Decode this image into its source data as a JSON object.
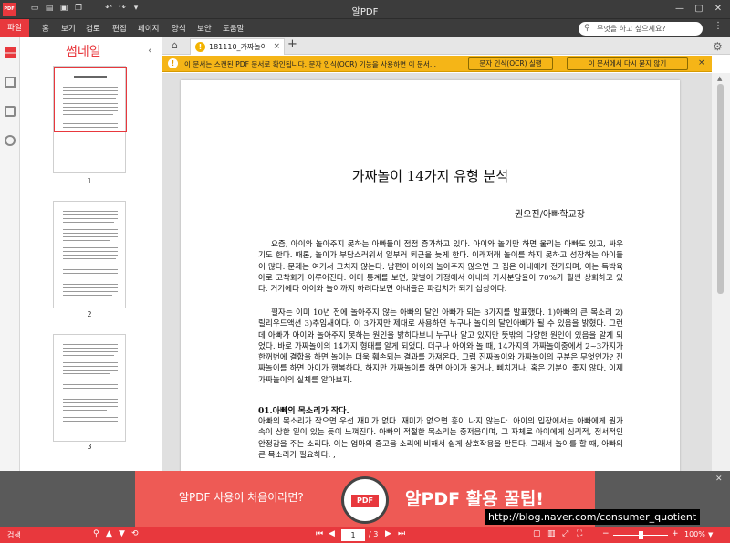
{
  "app": {
    "title": "알PDF",
    "logo_text": "PDF"
  },
  "quick_access": [
    "open-icon",
    "save-icon",
    "print-icon",
    "copy-icon",
    "undo-icon",
    "redo-icon",
    "customize-icon"
  ],
  "menu": {
    "file": "파일",
    "items": [
      "홈",
      "보기",
      "검토",
      "편집",
      "페이지",
      "양식",
      "보안",
      "도움말"
    ]
  },
  "search": {
    "placeholder": "무엇을 하고 싶으세요?"
  },
  "sidebar": {
    "title": "썸네일",
    "pages": [
      "1",
      "2",
      "3"
    ]
  },
  "tab": {
    "label": "181110_가짜놀이",
    "close": "×"
  },
  "ocr_bar": {
    "message": "이 문서는 스캔된 PDF 문서로 확인됩니다. 문자 인식(OCR) 기능을 사용하면 이 문서...",
    "run_button": "문자 인식(OCR) 실행",
    "dismiss_button": "이 문서에서 다시 묻지 않기",
    "close": "×"
  },
  "document": {
    "title": "가짜놀이 14가지 유형 분석",
    "author": "권오진/아빠학교장",
    "para1": "요즘, 아이와 놀아주지 못하는 아빠들이 점점 증가하고 있다. 아이와 놀기만 하면 울리는 아빠도 있고, 싸우기도 한다. 때론, 놀이가 부담스러워서 일부러 퇴근을 늦게 한다. 이래저래 놀이를 하지 못하고 성장하는 아이들이 많다. 문제는 여기서 그치지 않는다. 남편이 아이와 놀아주지 않으면 그 짐은 아내에게 전가되며, 이는 독박육아로 고착화가 이루어진다. 이미 통계를 보면, 맞벌이 가정에서 아내의 가사분담율이 70%가 훨씬 상회하고 있다. 거기에다 아이와 놀이까지 하려다보면 아내들은 파김치가 되기 십상이다.",
    "para2": "필자는 이미 10년 전에 놀아주지 않는 아빠의 달인 아빠가 되는 3가지를 발표했다. 1)아빠의 큰 목소리 2)릴리우드액션 3)추임새이다. 이 3가지만 제대로 사용하면 누구나 놀이의 달인아빠가 될 수 있음을 밝혔다. 그런데 아빠가 아이와 놀아주지 못하는 원인을 밝히다보니 누구나 알고 있지만 뜻밖의 다양한 원인이 있음을 알게 되었다. 바로 가짜놀이의 14가지 형태를 알게 되었다. 더구나 아이와 놀 때, 14가지의 가짜놀이중에서 2~3가지가 한꺼번에 결합을 하면 놀이는 더욱 훼손되는 결과를 가져온다. 그럼 진짜놀이와 가짜놀이의 구분은 무엇인가? 진짜놀이를 하면 아이가 행복하다. 하지만 가짜놀이를 하면 아이가 울거나, 삐치거나, 혹은 기분이 좋지 않다. 이제 가짜놀이의 실체를 알아보자.",
    "heading": "01.아빠의 목소리가 작다.",
    "para3": "아빠의 목소리가 작으면 우선 재미가 없다. 재미가 없으면 흥이 나지 않는다. 아이의 입장에서는 아빠에게 뭔가 속이 상한 일이 있는 듯이 느껴진다. 아빠의 적절한 목소리는 중저음이며, 그 자체로 아이에게 심리적, 정서적인 안정감을 주는 소리다. 이는 엄마의 중고음 소리에 비해서 쉽게 상호작용을 만든다. 그래서 놀이를 할 때, 아빠의 큰 목소리가 필요하다. ,"
  },
  "banner": {
    "left_text": "알PDF 사용이 처음이라면?",
    "mascot_label": "PDF",
    "right_text": "알PDF 활용 꿀팁!"
  },
  "watermark_url": "http://blog.naver.com/consumer_quotient",
  "status": {
    "search_label": "검색",
    "current_page": "1",
    "total_pages": "/ 3",
    "zoom": "100%"
  }
}
